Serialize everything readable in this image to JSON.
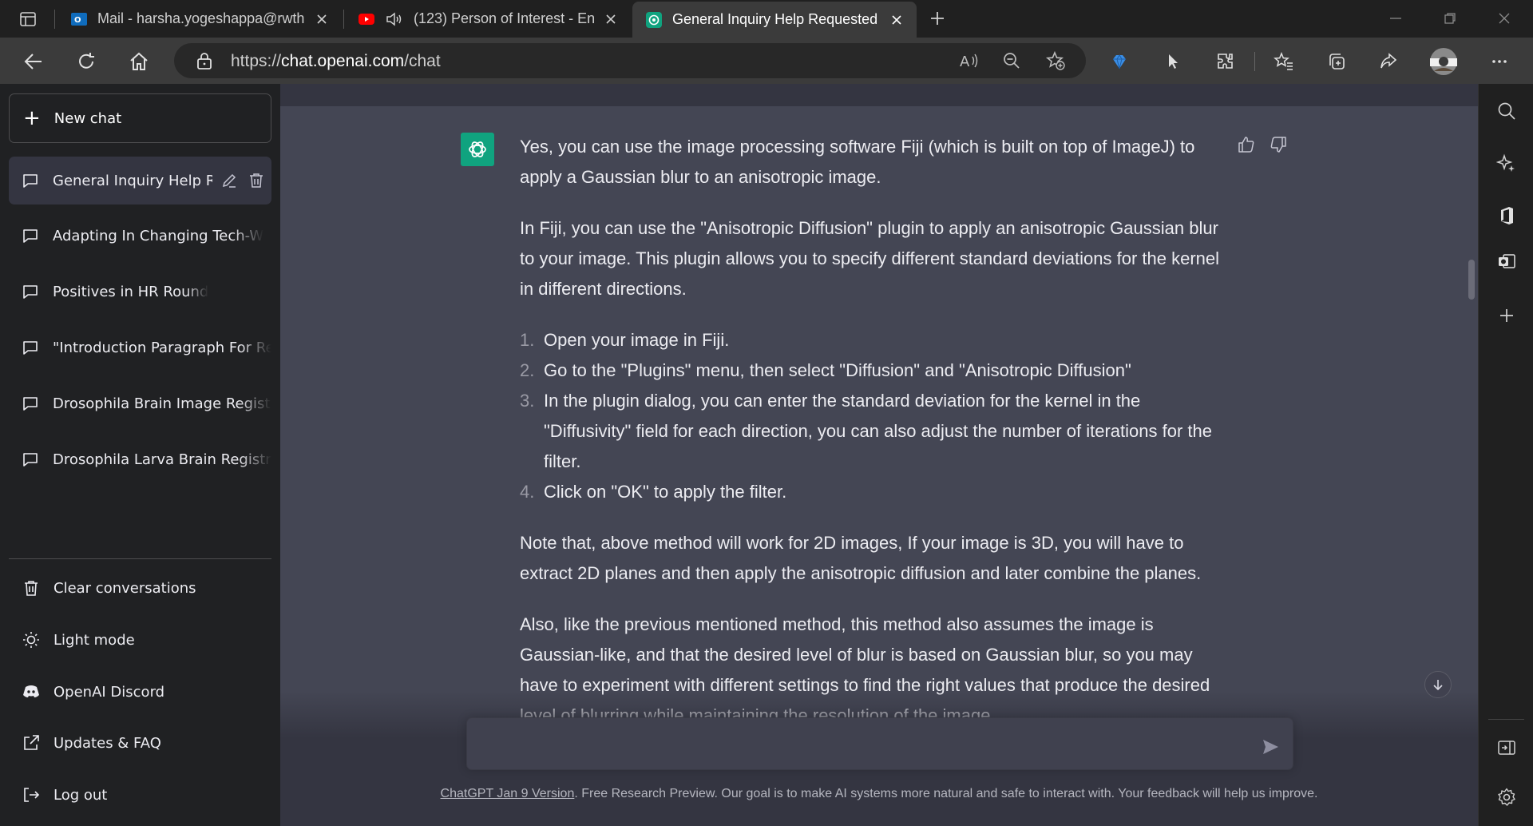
{
  "browser": {
    "tabs": [
      {
        "label": "Mail - harsha.yogeshappa@rwth",
        "icon": "outlook-icon"
      },
      {
        "label": "(123) Person of Interest - En",
        "icon": "youtube-icon"
      },
      {
        "label": "General Inquiry Help Requested",
        "icon": "chatgpt-icon",
        "active": true
      }
    ],
    "url_prefix": "https://",
    "url_host": "chat.openai.com",
    "url_path": "/chat"
  },
  "sidebar": {
    "new_chat": "New chat",
    "conversations": [
      {
        "label": "General Inquiry Help Re",
        "active": true
      },
      {
        "label": "Adapting In Changing Tech-W"
      },
      {
        "label": "Positives in HR Round"
      },
      {
        "label": "\"Introduction Paragraph For Re"
      },
      {
        "label": "Drosophila Brain Image Registr"
      },
      {
        "label": "Drosophila Larva Brain Registra"
      }
    ],
    "bottom": [
      {
        "label": "Clear conversations",
        "icon": "trash-icon"
      },
      {
        "label": "Light mode",
        "icon": "sun-icon"
      },
      {
        "label": "OpenAI Discord",
        "icon": "discord-icon"
      },
      {
        "label": "Updates & FAQ",
        "icon": "external-link-icon"
      },
      {
        "label": "Log out",
        "icon": "logout-icon"
      }
    ]
  },
  "chat": {
    "p1": "Yes, you can use the image processing software Fiji (which is built on top of ImageJ) to apply a Gaussian blur to an anisotropic image.",
    "p2": "In Fiji, you can use the \"Anisotropic Diffusion\" plugin to apply an anisotropic Gaussian blur to your image. This plugin allows you to specify different standard deviations for the kernel in different directions.",
    "steps": [
      {
        "num": "1.",
        "text": "Open your image in Fiji."
      },
      {
        "num": "2.",
        "text": "Go to the \"Plugins\" menu, then select \"Diffusion\" and \"Anisotropic Diffusion\""
      },
      {
        "num": "3.",
        "text": "In the plugin dialog, you can enter the standard deviation for the kernel in the \"Diffusivity\" field for each direction, you can also adjust the number of iterations for the filter."
      },
      {
        "num": "4.",
        "text": "Click on \"OK\" to apply the filter."
      }
    ],
    "p3": "Note that, above method will work for 2D images, If your image is 3D, you will have to extract 2D planes and then apply the anisotropic diffusion and later combine the planes.",
    "p4": "Also, like the previous mentioned method, this method also assumes the image is Gaussian-like, and that the desired level of blur is based on Gaussian blur, so you may have to experiment with different settings to find the right values that produce the desired level of blurring while maintaining the resolution of the image."
  },
  "input": {
    "value": "",
    "placeholder": ""
  },
  "footer": {
    "link": "ChatGPT Jan 9 Version",
    "text": ". Free Research Preview. Our goal is to make AI systems more natural and safe to interact with. Your feedback will help us improve."
  },
  "colors": {
    "accent": "#10a37f",
    "sidebar": "#202123",
    "main": "#444654",
    "input": "#40414f"
  }
}
